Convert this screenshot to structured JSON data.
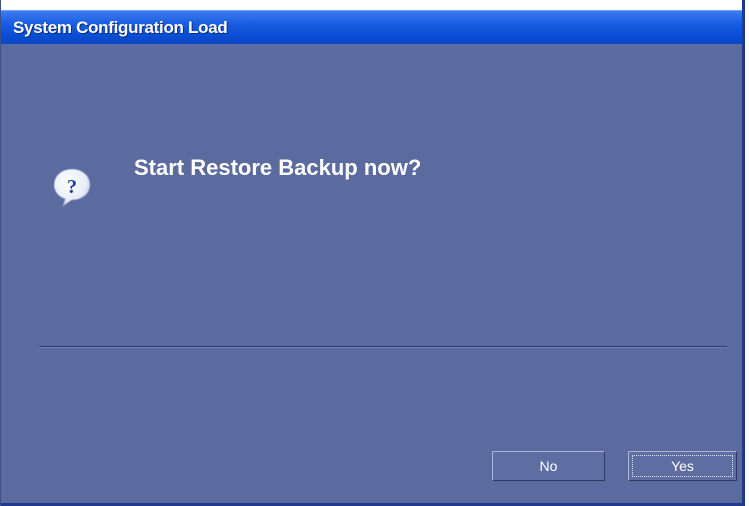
{
  "window": {
    "title": "System Configuration Load"
  },
  "dialog": {
    "icon": "question-icon",
    "message": "Start Restore Backup now?"
  },
  "buttons": {
    "no_label": "No",
    "yes_label": "Yes",
    "default": "Yes"
  },
  "colors": {
    "titlebar": "#0a4fd6",
    "background": "#5b6a9f",
    "text": "#ffffff"
  }
}
